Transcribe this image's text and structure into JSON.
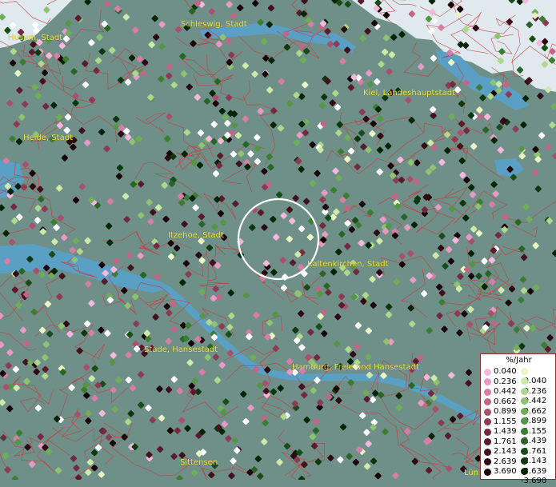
{
  "colors": {
    "land": "#6f9088",
    "water": "#5a9fc4",
    "sea": "#dfe9ee",
    "boundary": "#c8383a",
    "label": "#f4e33a",
    "circle": "#ffffff"
  },
  "cities": [
    {
      "id": "husum",
      "name": "Husum, Stadt"
    },
    {
      "id": "schleswig",
      "name": "Schleswig, Stadt"
    },
    {
      "id": "kiel",
      "name": "Kiel, Landeshauptstadt"
    },
    {
      "id": "heide",
      "name": "Heide, Stadt"
    },
    {
      "id": "itzehoe",
      "name": "Itzehoe, Stadt"
    },
    {
      "id": "kaltenkirchen",
      "name": "Kaltenkirchen, Stadt"
    },
    {
      "id": "stade",
      "name": "Stade, Hansestadt"
    },
    {
      "id": "hamburg",
      "name": "Hamburg, Freie und Hansestadt"
    },
    {
      "id": "sittensen",
      "name": "Sittensen"
    },
    {
      "id": "lun",
      "name": "Lün"
    }
  ],
  "legend": {
    "title": "%/Jahr",
    "positive": [
      {
        "value": "0.040",
        "color": "#f5b7dc"
      },
      {
        "value": "0.236",
        "color": "#e79ac4"
      },
      {
        "value": "0.442",
        "color": "#d77da6"
      },
      {
        "value": "0.662",
        "color": "#c26688"
      },
      {
        "value": "0.899",
        "color": "#a9506d"
      },
      {
        "value": "1.155",
        "color": "#8d3b54"
      },
      {
        "value": "1.439",
        "color": "#732a40"
      },
      {
        "value": "1.761",
        "color": "#5a1c2d"
      },
      {
        "value": "2.143",
        "color": "#43111e"
      },
      {
        "value": "2.639",
        "color": "#2e0912"
      },
      {
        "value": "3.690",
        "color": "#1a0308"
      }
    ],
    "negative": [
      {
        "value": "-0.040",
        "color": "#eaf6c6"
      },
      {
        "value": "-0.236",
        "color": "#cdeaa8"
      },
      {
        "value": "-0.442",
        "color": "#aed88b"
      },
      {
        "value": "-0.662",
        "color": "#8ec471"
      },
      {
        "value": "-0.899",
        "color": "#6fae59"
      },
      {
        "value": "-1.155",
        "color": "#549645"
      },
      {
        "value": "-1.439",
        "color": "#3c7d34"
      },
      {
        "value": "-1.761",
        "color": "#286526"
      },
      {
        "value": "-2.143",
        "color": "#174d19"
      },
      {
        "value": "-2.639",
        "color": "#0b380f"
      },
      {
        "value": "-3.690",
        "color": "#032407"
      }
    ]
  }
}
